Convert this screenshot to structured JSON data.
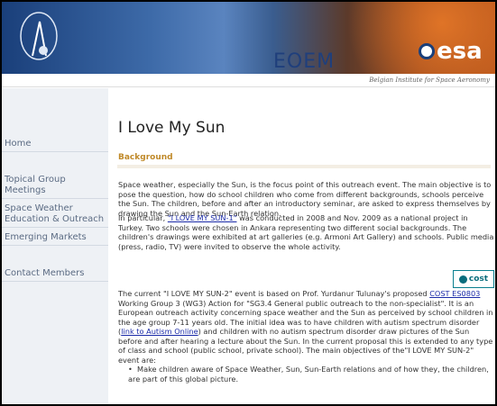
{
  "header": {
    "eoem_label": "EOEM",
    "esa_label": "esa",
    "institute": "Belgian Institute for Space Aeronomy"
  },
  "sidebar": {
    "items": [
      {
        "label": "Home"
      },
      {
        "label": "Topical Group Meetings"
      },
      {
        "label": "Space Weather Education & Outreach"
      },
      {
        "label": "Emerging Markets"
      },
      {
        "label": "Contact Members"
      }
    ]
  },
  "main": {
    "title": "I Love My Sun",
    "section_heading": "Background",
    "p1": "Space weather, especially the Sun, is the focus point of this outreach event. The main objective is to pose the question, how do school children who come from different backgrounds, schools perceive the Sun. The children, before and after an introductory seminar, are asked to express themselves by drawing the Sun and the Sun-Earth relation.",
    "p2_pre": "In particular, ",
    "p2_link": "\"I LOVE MY SUN-1\"",
    "p2_post": " was conducted in 2008 and Nov. 2009 as a national project in Turkey. Two schools were chosen in Ankara representing two different social backgrounds. The children's drawings were exhibited at art galleries (e.g. Armoni Art Gallery) and schools. Public media (press, radio, TV) were invited to observe the whole activity.",
    "cost_label": "cost",
    "p3_pre": "The current \"I LOVE MY SUN-2\" event is based on Prof. Yurdanur Tulunay's proposed ",
    "p3_link1": "COST ES0803",
    "p3_mid": " Working Group 3 (WG3) Action for \"SG3.4 General public outreach to the non-specialist\". It is an European outreach activity concerning space weather and the Sun as perceived by school children in the age group 7-11 years old. The initial idea was to have children with autism spectrum disorder (",
    "p3_link2": "link to Autism Online",
    "p3_post": ") and children with no autism spectrum disorder draw pictures of the Sun before and after hearing a lecture about the Sun. In the current proposal this is extended to any type of class and school (public school, private school). The main objectives of the\"I LOVE MY SUN-2\" event are:",
    "bullet1": "Make children aware of Space Weather, Sun, Sun-Earth relations and of how they, the children, are part of this global picture."
  }
}
